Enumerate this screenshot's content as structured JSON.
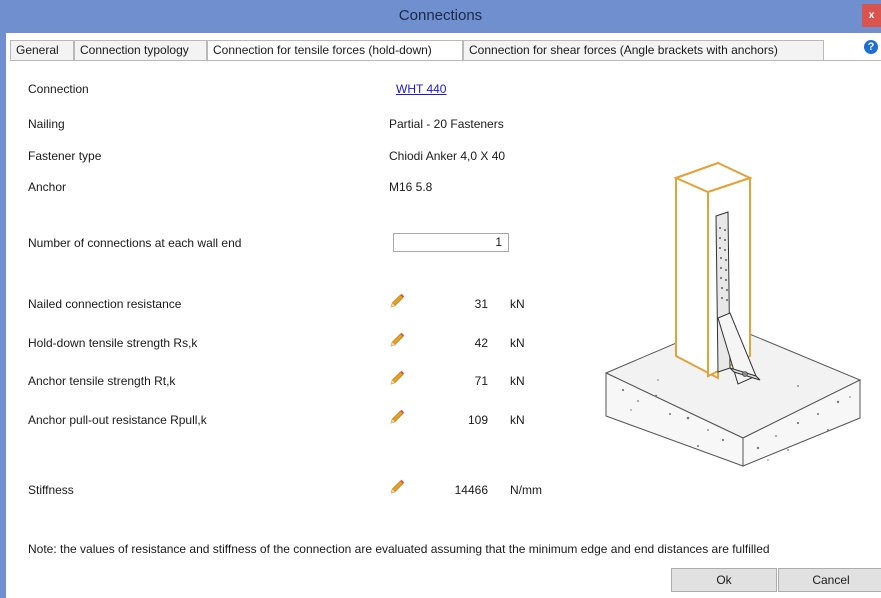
{
  "window": {
    "title": "Connections",
    "close_label": "x"
  },
  "tabs": [
    {
      "label": "General"
    },
    {
      "label": "Connection typology"
    },
    {
      "label": "Connection for tensile forces (hold-down)"
    },
    {
      "label": "Connection for shear forces (Angle brackets with anchors)"
    }
  ],
  "help_label": "?",
  "info": {
    "connection_label": "Connection",
    "connection_value": "WHT 440",
    "nailing_label": "Nailing",
    "nailing_value": "Partial - 20 Fasteners",
    "fastener_label": "Fastener type",
    "fastener_value": "Chiodi Anker 4,0 X 40",
    "anchor_label": "Anchor",
    "anchor_value": "M16 5.8"
  },
  "count": {
    "label": "Number of connections at each wall end",
    "value": "1"
  },
  "results": [
    {
      "label": "Nailed connection resistance",
      "value": "31",
      "unit": "kN"
    },
    {
      "label": "Hold-down tensile strength Rs,k",
      "value": "42",
      "unit": "kN"
    },
    {
      "label": "Anchor tensile strength  Rt,k",
      "value": "71",
      "unit": "kN"
    },
    {
      "label": "Anchor pull-out resistance Rpull,k",
      "value": "109",
      "unit": "kN"
    }
  ],
  "stiffness": {
    "label": "Stiffness",
    "value": "14466",
    "unit": "N/mm"
  },
  "note": "Note: the values of resistance and stiffness of the connection are evaluated assuming that the minimum edge and end distances are fulfilled",
  "buttons": {
    "ok": "Ok",
    "cancel": "Cancel"
  },
  "colors": {
    "titlebar": "#6f8fcf",
    "wall_outline": "#e2a33a",
    "link": "#1a1ad9",
    "pencil": "#e8a020"
  }
}
